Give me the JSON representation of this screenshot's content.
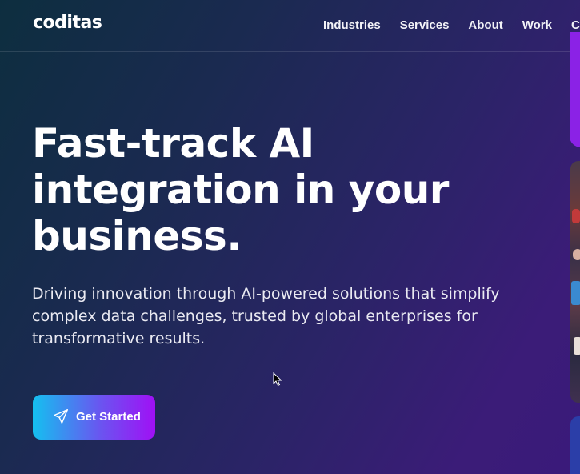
{
  "brand": {
    "logo_text": "coditas"
  },
  "nav": {
    "items": [
      "Industries",
      "Services",
      "About",
      "Work",
      "Care"
    ]
  },
  "hero": {
    "title": "Fast-track AI integration in your business.",
    "subtitle": "Driving innovation through AI-powered solutions that simplify complex data challenges, trusted by global enterprises for transformative results.",
    "cta_label": "Get Started",
    "cta_icon": "send-icon"
  },
  "colors": {
    "cta_gradient_start": "#14c0f0",
    "cta_gradient_end": "#a010f5",
    "background_start": "#0d2e3f",
    "background_end": "#3a1a7a"
  }
}
